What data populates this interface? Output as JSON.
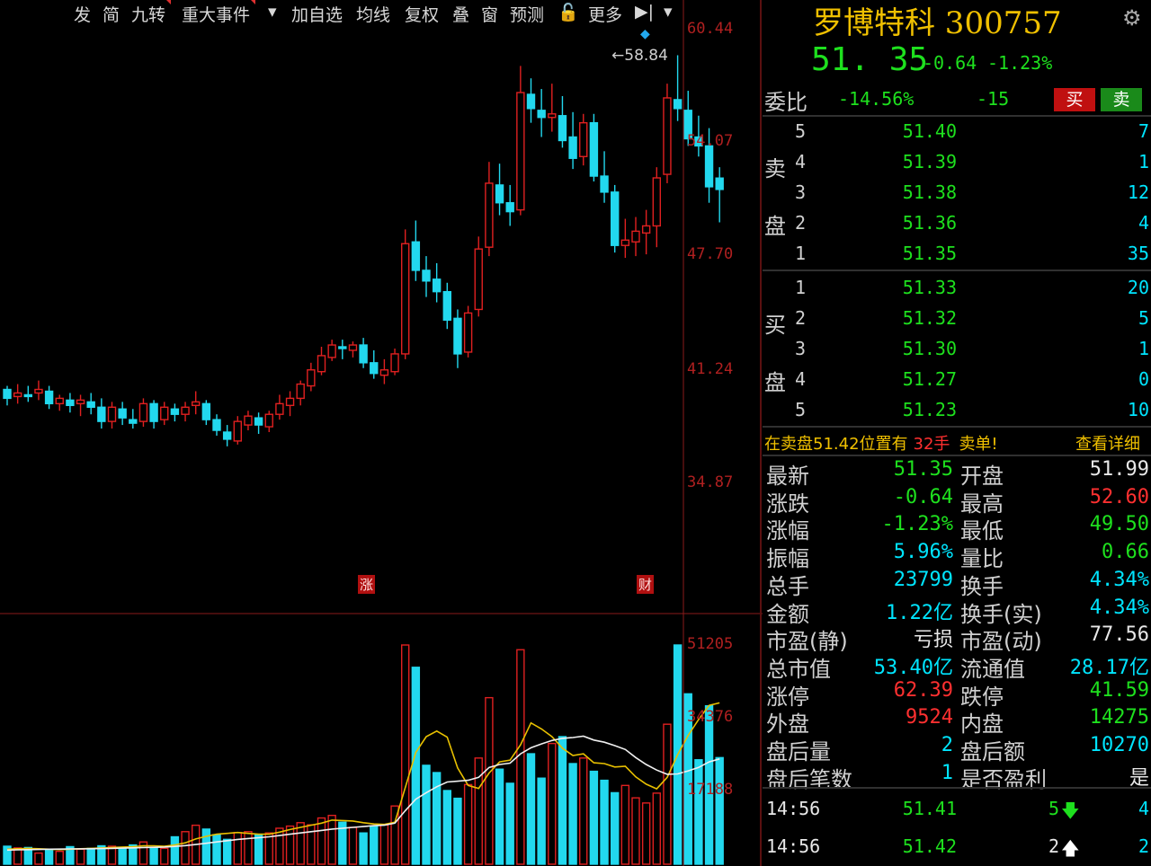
{
  "toolbar": [
    {
      "label": "发",
      "tri": false
    },
    {
      "label": "简",
      "tri": false
    },
    {
      "label": "九转",
      "tri": true
    },
    {
      "label": "重大事件",
      "tri": true
    },
    {
      "label": "▾",
      "tri": false
    },
    {
      "label": "加自选",
      "tri": false
    },
    {
      "label": "均线",
      "tri": false
    },
    {
      "label": "复权",
      "tri": false
    },
    {
      "label": "叠",
      "tri": false
    },
    {
      "label": "窗",
      "tri": false
    },
    {
      "label": "预测",
      "tri": false
    },
    {
      "label": "🔓",
      "tri": false
    },
    {
      "label": "更多",
      "tri": false
    },
    {
      "label": "▶|",
      "tri": false
    },
    {
      "label": "▾",
      "tri": false
    }
  ],
  "stock": {
    "name_code": "罗博特科 300757",
    "price": "51. 35",
    "change": "-0.64",
    "change_pct": "-1.23%"
  },
  "weibi": {
    "label": "委比",
    "pct": "-14.56%",
    "diff": "-15",
    "buy": "买",
    "sell": "卖"
  },
  "orderbook": {
    "sell_label_1": "卖",
    "sell_label_2": "盘",
    "buy_label_1": "买",
    "buy_label_2": "盘",
    "asks": [
      {
        "level": "5",
        "price": "51.40",
        "vol": "7"
      },
      {
        "level": "4",
        "price": "51.39",
        "vol": "1"
      },
      {
        "level": "3",
        "price": "51.38",
        "vol": "12"
      },
      {
        "level": "2",
        "price": "51.36",
        "vol": "4"
      },
      {
        "level": "1",
        "price": "51.35",
        "vol": "35"
      }
    ],
    "bids": [
      {
        "level": "1",
        "price": "51.33",
        "vol": "20"
      },
      {
        "level": "2",
        "price": "51.32",
        "vol": "5"
      },
      {
        "level": "3",
        "price": "51.30",
        "vol": "1"
      },
      {
        "level": "4",
        "price": "51.27",
        "vol": "0"
      },
      {
        "level": "5",
        "price": "51.23",
        "vol": "10"
      }
    ]
  },
  "notice": {
    "text_1": "在卖盘51.42位置有",
    "qty": "32手",
    "text_2": "卖单!",
    "link": "查看详细"
  },
  "stats": [
    {
      "l1": "最新",
      "v1": "51.35",
      "c1": "g",
      "l2": "开盘",
      "v2": "51.99",
      "c2": "w"
    },
    {
      "l1": "涨跌",
      "v1": "-0.64",
      "c1": "g",
      "l2": "最高",
      "v2": "52.60",
      "c2": "r"
    },
    {
      "l1": "涨幅",
      "v1": "-1.23%",
      "c1": "g",
      "l2": "最低",
      "v2": "49.50",
      "c2": "g"
    },
    {
      "l1": "振幅",
      "v1": "5.96%",
      "c1": "c",
      "l2": "量比",
      "v2": "0.66",
      "c2": "g"
    },
    {
      "l1": "总手",
      "v1": "23799",
      "c1": "c",
      "l2": "换手",
      "v2": "4.34%",
      "c2": "c"
    },
    {
      "l1": "金额",
      "v1": "1.22亿",
      "c1": "c",
      "l2": "换手(实)",
      "v2": "4.34%",
      "c2": "c"
    },
    {
      "l1": "市盈(静)",
      "v1": "亏损",
      "c1": "w",
      "l2": "市盈(动)",
      "v2": "77.56",
      "c2": "w"
    },
    {
      "l1": "总市值",
      "v1": "53.40亿",
      "c1": "c",
      "l2": "流通值",
      "v2": "28.17亿",
      "c2": "c"
    },
    {
      "l1": "涨停",
      "v1": "62.39",
      "c1": "r",
      "l2": "跌停",
      "v2": "41.59",
      "c2": "g"
    },
    {
      "l1": "外盘",
      "v1": "9524",
      "c1": "r",
      "l2": "内盘",
      "v2": "14275",
      "c2": "g"
    },
    {
      "l1": "盘后量",
      "v1": "2",
      "c1": "c",
      "l2": "盘后额",
      "v2": "10270",
      "c2": "c"
    },
    {
      "l1": "盘后笔数",
      "v1": "1",
      "c1": "c",
      "l2": "是否盈利",
      "v2": "是",
      "c2": "w"
    }
  ],
  "ticks": [
    {
      "time": "14:56",
      "price": "51.41",
      "vol": "5",
      "dir": "down",
      "count": "4"
    },
    {
      "time": "14:56",
      "price": "51.42",
      "vol": "2",
      "dir": "up",
      "count": "2"
    }
  ],
  "kline": {
    "price_axis": [
      "60.44",
      "54.07",
      "47.70",
      "41.24",
      "34.87"
    ],
    "high_marker": "58.84",
    "event_tags": [
      "涨",
      "财"
    ],
    "volume_axis": [
      "51205",
      "34376",
      "17188"
    ]
  },
  "colors": {
    "up": "#e02020",
    "down": "#22d8ee",
    "ma1": "#e8c000",
    "ma2": "#f0f0f0",
    "axis": "#b02020"
  },
  "chart_data": {
    "type": "candlestick",
    "ylim": [
      34.87,
      60.44
    ],
    "candles": [
      [
        40.1,
        40.3,
        39.2,
        39.6
      ],
      [
        39.7,
        40.4,
        39.3,
        39.9
      ],
      [
        39.8,
        40.3,
        39.4,
        39.7
      ],
      [
        39.9,
        40.6,
        39.5,
        40.1
      ],
      [
        40.0,
        40.3,
        39.0,
        39.3
      ],
      [
        39.3,
        39.8,
        38.9,
        39.6
      ],
      [
        39.5,
        39.9,
        38.8,
        39.2
      ],
      [
        39.3,
        39.8,
        38.6,
        39.5
      ],
      [
        39.4,
        39.9,
        38.7,
        39.1
      ],
      [
        39.1,
        39.6,
        37.9,
        38.3
      ],
      [
        38.3,
        39.4,
        37.9,
        39.1
      ],
      [
        39.0,
        39.4,
        38.1,
        38.5
      ],
      [
        38.4,
        39.0,
        37.9,
        38.2
      ],
      [
        38.3,
        39.6,
        38.0,
        39.3
      ],
      [
        39.3,
        39.5,
        37.9,
        38.3
      ],
      [
        38.4,
        39.4,
        38.1,
        39.1
      ],
      [
        39.0,
        39.3,
        38.3,
        38.7
      ],
      [
        38.7,
        39.4,
        38.3,
        39.1
      ],
      [
        39.2,
        40.0,
        38.7,
        39.4
      ],
      [
        39.3,
        39.5,
        38.1,
        38.4
      ],
      [
        38.4,
        38.7,
        37.5,
        37.8
      ],
      [
        37.7,
        38.1,
        36.9,
        37.3
      ],
      [
        37.2,
        38.6,
        37.0,
        38.3
      ],
      [
        38.1,
        38.9,
        37.8,
        38.6
      ],
      [
        38.5,
        38.8,
        37.6,
        38.1
      ],
      [
        38.0,
        38.9,
        37.7,
        38.7
      ],
      [
        38.7,
        39.8,
        38.4,
        39.3
      ],
      [
        39.2,
        40.0,
        38.6,
        39.6
      ],
      [
        39.6,
        40.6,
        39.2,
        40.4
      ],
      [
        40.3,
        41.6,
        40.0,
        41.2
      ],
      [
        41.1,
        42.5,
        40.9,
        42.0
      ],
      [
        41.9,
        42.9,
        41.7,
        42.6
      ],
      [
        42.5,
        42.9,
        41.8,
        42.4
      ],
      [
        42.3,
        42.8,
        41.9,
        42.6
      ],
      [
        42.6,
        43.0,
        41.3,
        41.6
      ],
      [
        41.6,
        42.3,
        40.7,
        41.0
      ],
      [
        40.9,
        41.8,
        40.4,
        41.2
      ],
      [
        41.1,
        42.4,
        40.9,
        42.1
      ],
      [
        42.1,
        49.1,
        41.8,
        48.3
      ],
      [
        48.4,
        49.6,
        46.2,
        46.8
      ],
      [
        46.8,
        47.6,
        45.3,
        46.2
      ],
      [
        46.3,
        47.2,
        45.0,
        45.6
      ],
      [
        45.6,
        46.1,
        43.5,
        44.0
      ],
      [
        44.1,
        44.6,
        41.3,
        42.1
      ],
      [
        42.2,
        44.8,
        41.9,
        44.4
      ],
      [
        44.6,
        48.7,
        44.2,
        48.0
      ],
      [
        48.1,
        52.9,
        47.6,
        51.7
      ],
      [
        51.6,
        52.8,
        49.9,
        50.6
      ],
      [
        50.6,
        51.6,
        49.3,
        50.1
      ],
      [
        50.2,
        58.3,
        49.9,
        56.8
      ],
      [
        56.7,
        57.6,
        55.1,
        55.9
      ],
      [
        55.8,
        57.0,
        54.3,
        55.4
      ],
      [
        55.4,
        57.3,
        54.6,
        55.6
      ],
      [
        55.5,
        56.6,
        53.7,
        54.1
      ],
      [
        54.3,
        55.7,
        52.5,
        53.1
      ],
      [
        53.2,
        55.6,
        52.7,
        55.1
      ],
      [
        55.1,
        55.6,
        51.8,
        52.1
      ],
      [
        52.1,
        53.5,
        50.6,
        51.2
      ],
      [
        51.2,
        51.6,
        47.8,
        48.2
      ],
      [
        48.2,
        49.7,
        47.5,
        48.5
      ],
      [
        48.4,
        49.8,
        47.6,
        49.0
      ],
      [
        48.9,
        50.2,
        47.7,
        49.3
      ],
      [
        49.3,
        52.6,
        48.1,
        52.0
      ],
      [
        52.2,
        57.3,
        51.7,
        56.5
      ],
      [
        56.4,
        58.9,
        55.2,
        55.9
      ],
      [
        55.8,
        56.9,
        53.8,
        54.2
      ],
      [
        54.3,
        55.5,
        53.2,
        53.8
      ],
      [
        53.8,
        54.8,
        50.6,
        51.5
      ],
      [
        51.99,
        52.6,
        49.5,
        51.35
      ]
    ],
    "volume_ylim": [
      0,
      51205
    ],
    "volumes": [
      4200,
      3800,
      3900,
      2600,
      3400,
      3000,
      4100,
      3500,
      3700,
      4300,
      4200,
      3800,
      4500,
      5200,
      3900,
      3700,
      6400,
      7600,
      9100,
      8200,
      6900,
      5800,
      7400,
      7600,
      6800,
      7300,
      8400,
      8900,
      9700,
      9200,
      10800,
      11400,
      9800,
      8600,
      7300,
      8900,
      9200,
      13600,
      51205,
      46000,
      23100,
      21400,
      17200,
      15400,
      18600,
      24800,
      38900,
      22200,
      18900,
      50100,
      25800,
      20100,
      28200,
      29800,
      23500,
      24800,
      21700,
      19600,
      16700,
      18400,
      15500,
      14300,
      16600,
      32700,
      51205,
      39800,
      24400,
      37000,
      24900
    ],
    "ma_short": [
      3500,
      3600,
      3700,
      3600,
      3500,
      3400,
      3500,
      3600,
      3700,
      3800,
      3900,
      4000,
      4100,
      4300,
      4300,
      4200,
      4500,
      5000,
      5900,
      6500,
      7000,
      7200,
      7400,
      7200,
      7000,
      7000,
      7500,
      8100,
      8600,
      9100,
      9600,
      10300,
      10200,
      10100,
      9700,
      9400,
      9300,
      9800,
      17900,
      26100,
      29800,
      31100,
      29700,
      22500,
      18400,
      17700,
      21300,
      23900,
      24300,
      27900,
      33000,
      31600,
      29800,
      27100,
      25400,
      25800,
      23700,
      23500,
      22700,
      22900,
      20400,
      18700,
      17600,
      20300,
      25600,
      30100,
      33800,
      37100,
      37700
    ],
    "ma_long": [
      3300,
      3350,
      3400,
      3450,
      3500,
      3520,
      3560,
      3580,
      3600,
      3650,
      3700,
      3760,
      3820,
      3900,
      3950,
      4000,
      4150,
      4350,
      4600,
      4900,
      5200,
      5500,
      5800,
      6000,
      6200,
      6400,
      6700,
      7000,
      7300,
      7600,
      7900,
      8200,
      8400,
      8600,
      8800,
      9000,
      9100,
      9600,
      12500,
      15200,
      16700,
      18100,
      19200,
      19400,
      19600,
      20300,
      22600,
      23300,
      23600,
      25800,
      27200,
      28100,
      28900,
      29400,
      29600,
      29900,
      29000,
      28500,
      27700,
      26800,
      24900,
      23300,
      22000,
      21000,
      21100,
      21800,
      22600,
      23900,
      24600
    ]
  }
}
